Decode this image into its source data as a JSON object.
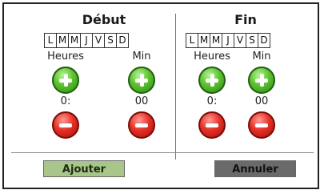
{
  "start": {
    "title": "Début",
    "days": [
      "L",
      "M",
      "M",
      "J",
      "V",
      "S",
      "D"
    ],
    "hours_label": "Heures",
    "minutes_label": "Min",
    "hours_value": "0:",
    "minutes_value": "00"
  },
  "end": {
    "title": "Fin",
    "days": [
      "L",
      "M",
      "M",
      "J",
      "V",
      "S",
      "D"
    ],
    "hours_label": "Heures",
    "minutes_label": "Min",
    "hours_value": "0:",
    "minutes_value": "00"
  },
  "actions": {
    "add_label": "Ajouter",
    "cancel_label": "Annuler"
  },
  "icons": {
    "increment": "plus-icon",
    "decrement": "minus-icon"
  },
  "colors": {
    "add_button": "#a8c689",
    "cancel_button": "#6a6a6a",
    "increment": "#5cc22e",
    "decrement": "#e63228"
  }
}
